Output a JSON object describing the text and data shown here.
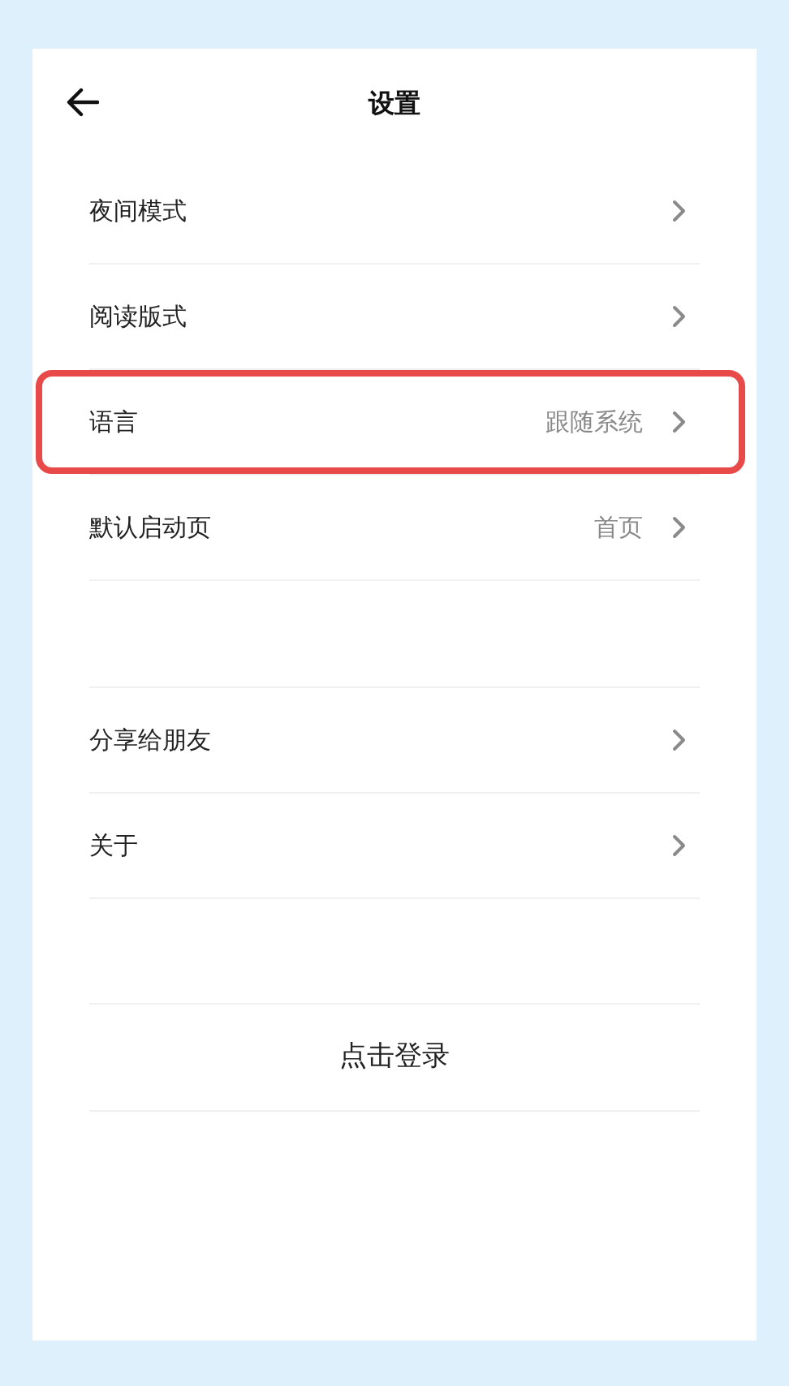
{
  "header": {
    "title": "设置"
  },
  "sections": [
    {
      "items": [
        {
          "label": "夜间模式",
          "highlighted": false
        },
        {
          "label": "阅读版式",
          "highlighted": false
        },
        {
          "label": "语言",
          "value": "跟随系统",
          "highlighted": true
        },
        {
          "label": "默认启动页",
          "value": "首页",
          "highlighted": false
        }
      ]
    },
    {
      "items": [
        {
          "label": "分享给朋友",
          "highlighted": false
        },
        {
          "label": "关于",
          "highlighted": false
        }
      ]
    }
  ],
  "login_button": "点击登录"
}
